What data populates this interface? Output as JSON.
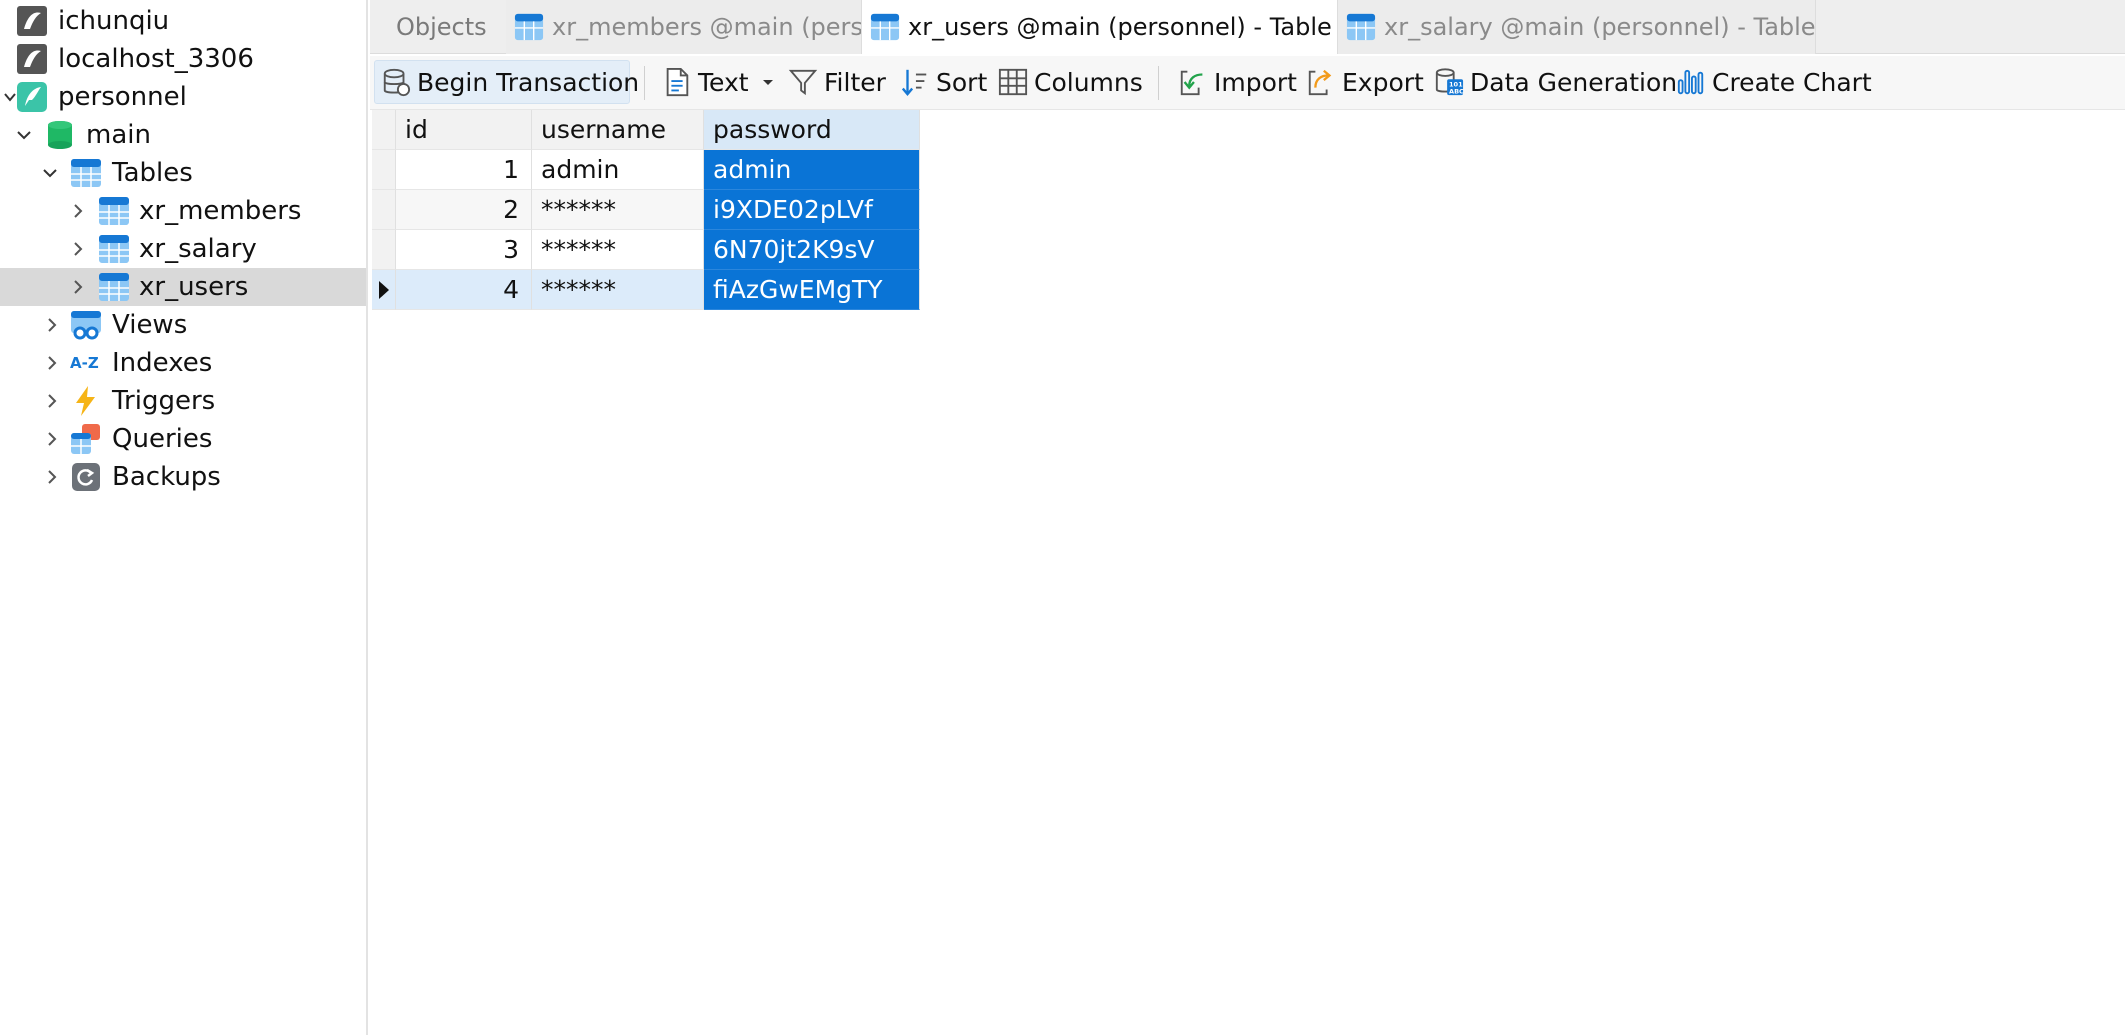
{
  "sidebar": {
    "items": [
      {
        "label": "ichunqiu",
        "icon": "connection-icon"
      },
      {
        "label": "localhost_3306",
        "icon": "connection-icon"
      },
      {
        "label": "personnel",
        "icon": "database-connection-icon"
      },
      {
        "label": "main",
        "icon": "schema-icon"
      },
      {
        "label": "Tables",
        "icon": "tables-icon"
      },
      {
        "label": "xr_members",
        "icon": "table-icon"
      },
      {
        "label": "xr_salary",
        "icon": "table-icon"
      },
      {
        "label": "xr_users",
        "icon": "table-icon",
        "selected": true
      },
      {
        "label": "Views",
        "icon": "views-icon"
      },
      {
        "label": "Indexes",
        "icon": "indexes-icon"
      },
      {
        "label": "Triggers",
        "icon": "triggers-icon"
      },
      {
        "label": "Queries",
        "icon": "queries-icon"
      },
      {
        "label": "Backups",
        "icon": "backups-icon"
      }
    ]
  },
  "tabs": {
    "objects": "Objects",
    "items": [
      {
        "label": "xr_members @main (personnel) - T...",
        "active": false
      },
      {
        "label": "xr_users @main (personnel) - Table",
        "active": true
      },
      {
        "label": "xr_salary @main (personnel) - Table",
        "active": false
      }
    ]
  },
  "toolbar": {
    "begin_transaction": "Begin Transaction",
    "text": "Text",
    "filter": "Filter",
    "sort": "Sort",
    "columns": "Columns",
    "import": "Import",
    "export": "Export",
    "data_generation": "Data Generation",
    "create_chart": "Create Chart"
  },
  "grid": {
    "columns": [
      "id",
      "username",
      "password"
    ],
    "rows": [
      {
        "id": "1",
        "username": "admin",
        "password": "admin"
      },
      {
        "id": "2",
        "username": "******",
        "password": "i9XDE02pLVf"
      },
      {
        "id": "3",
        "username": "******",
        "password": "6N70jt2K9sV"
      },
      {
        "id": "4",
        "username": "******",
        "password": "fiAzGwEMgTY"
      }
    ],
    "current_row": 3
  },
  "colors": {
    "selection_blue": "#0a74d6",
    "row_highlight": "#dcebfa",
    "sidebar_selected": "#d9d9d9"
  }
}
